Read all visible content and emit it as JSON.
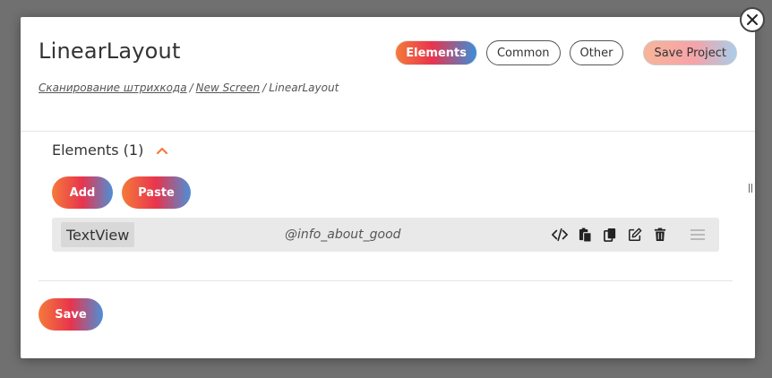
{
  "modal": {
    "title": "LinearLayout",
    "tabs": [
      {
        "label": "Elements",
        "active": true
      },
      {
        "label": "Common",
        "active": false
      },
      {
        "label": "Other",
        "active": false
      }
    ],
    "save_project_label": "Save Project",
    "breadcrumb": {
      "items": [
        "Сканирование штрихкода",
        "New Screen"
      ],
      "current": "LinearLayout",
      "separator": "/"
    },
    "section": {
      "title": "Elements (1)",
      "add_label": "Add",
      "paste_label": "Paste",
      "rows": [
        {
          "name": "TextView",
          "id": "@info_about_good",
          "actions": [
            "code-icon",
            "paste-icon",
            "copy-icon",
            "edit-icon",
            "trash-icon"
          ]
        }
      ]
    },
    "save_label": "Save"
  },
  "colors": {
    "gradient_start": "#f47a3a",
    "gradient_mid": "#e8344e",
    "gradient_end": "#3a8fd8",
    "accent_chevron": "#f47a3a",
    "backdrop": "#707070"
  }
}
